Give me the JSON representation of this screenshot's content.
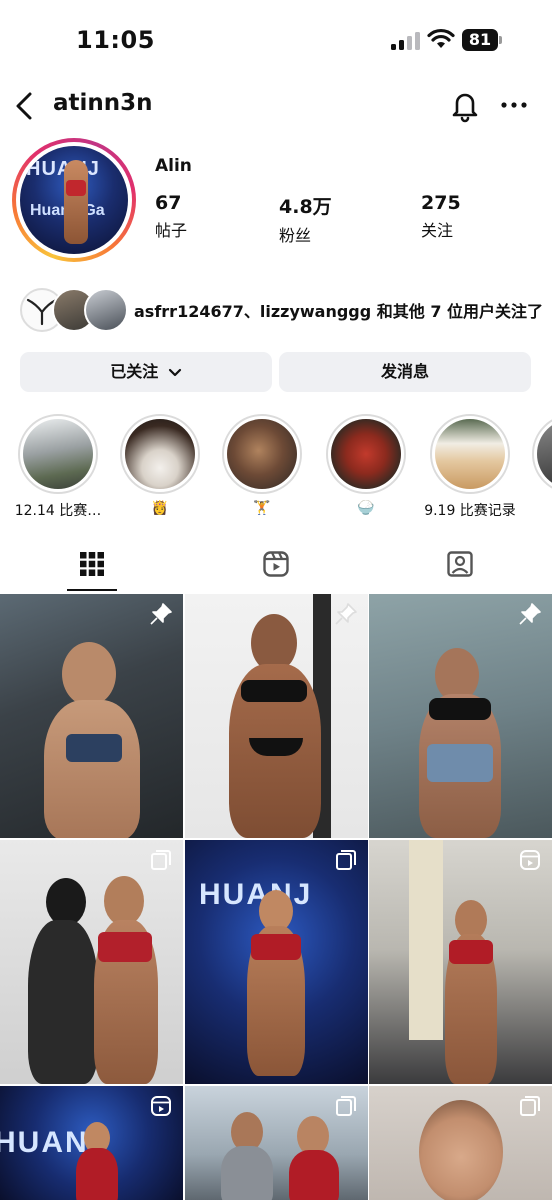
{
  "status": {
    "time": "11:05",
    "battery": "81"
  },
  "header": {
    "username": "atinn3n"
  },
  "profile": {
    "display_name": "Alin",
    "avatar_text_top": "HUANJ",
    "avatar_text_bottom": "Huanji Ga",
    "stats": [
      {
        "value": "67",
        "label": "帖子"
      },
      {
        "value": "4.8万",
        "label": "粉丝"
      },
      {
        "value": "275",
        "label": "关注"
      }
    ]
  },
  "followed_by": {
    "text": "asfrr124677、lizzywanggg 和其他 7 位用户关注了"
  },
  "actions": {
    "following_label": "已关注",
    "message_label": "发消息"
  },
  "highlights": [
    {
      "label": "12.14 比赛…"
    },
    {
      "label": "👸"
    },
    {
      "label": "🏋️"
    },
    {
      "label": "🍚"
    },
    {
      "label": "9.19 比赛记录"
    }
  ],
  "grid": {
    "posts": [
      {
        "badge": "pin",
        "caption": ""
      },
      {
        "badge": "pin",
        "caption": ""
      },
      {
        "badge": "pin",
        "caption": ""
      },
      {
        "badge": "carousel",
        "caption": ""
      },
      {
        "badge": "carousel",
        "caption": "HUANJ"
      },
      {
        "badge": "reel",
        "caption": ""
      },
      {
        "badge": "reel",
        "caption": "HUANJ"
      },
      {
        "badge": "carousel",
        "caption": ""
      },
      {
        "badge": "carousel",
        "caption": ""
      }
    ]
  },
  "colors": {
    "button_bg": "#eff0f3",
    "text": "#111111",
    "ring_border": "#dbdbdb"
  }
}
